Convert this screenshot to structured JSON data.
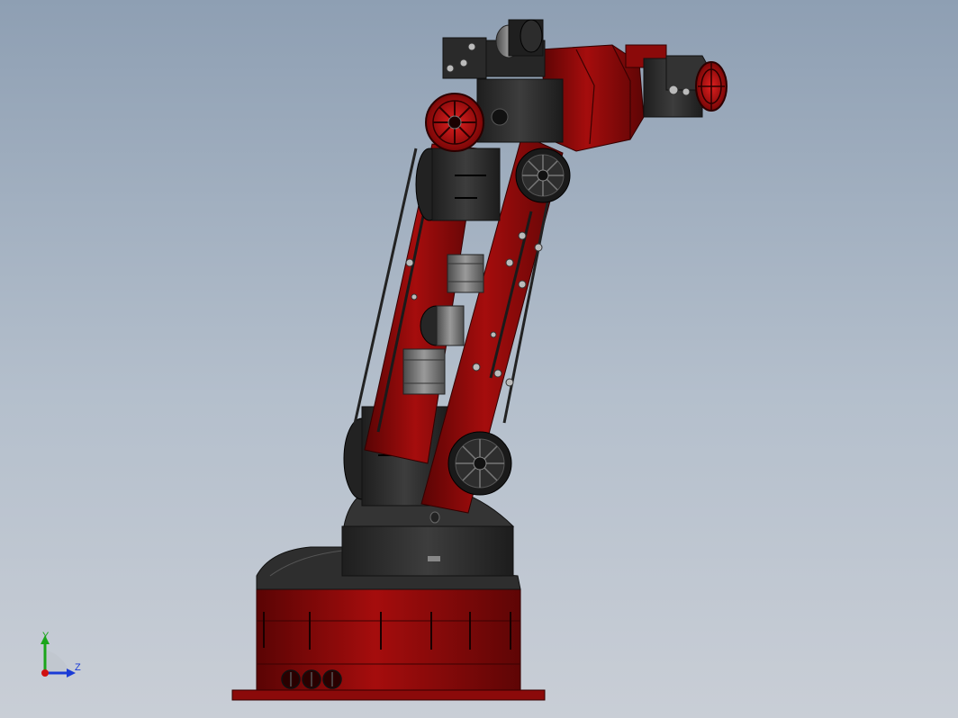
{
  "viewport": {
    "background_top": "#8e9fb3",
    "background_bottom": "#c9ced6"
  },
  "model": {
    "accent_color": "#8b0a0a",
    "accent_light": "#c41616",
    "dark_color": "#2b2b2b",
    "motor_color": "#6f6f6f"
  },
  "triad": {
    "y_label": "Y",
    "z_label": "Z",
    "y_color": "#1aa51a",
    "z_color": "#1a3bd6",
    "origin_color": "#d01010"
  }
}
